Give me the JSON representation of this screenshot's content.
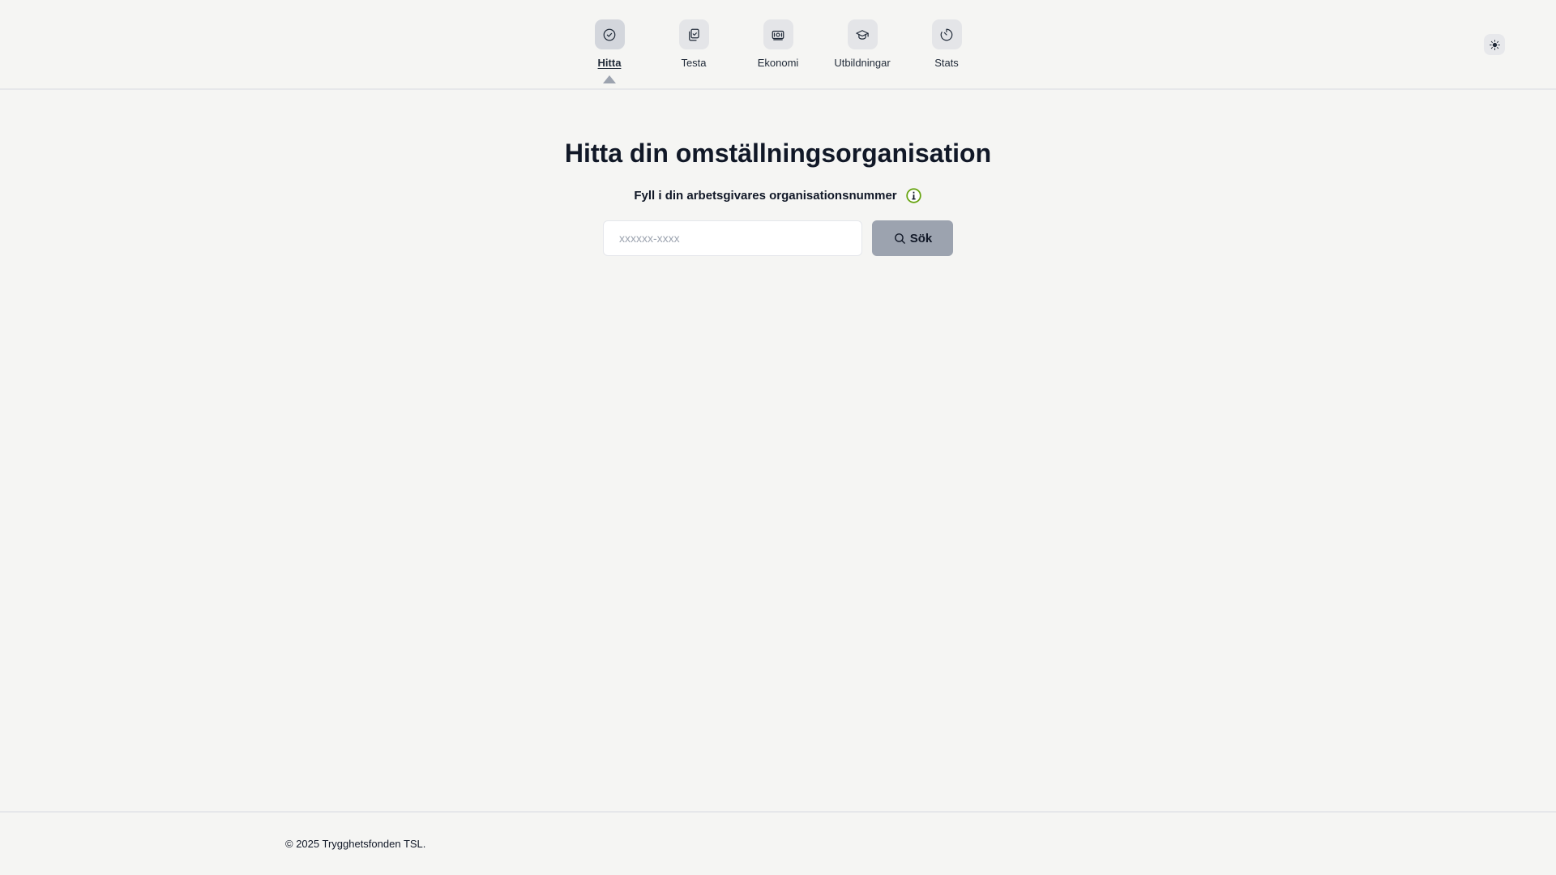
{
  "nav": {
    "items": [
      {
        "label": "Hitta",
        "icon": "check-circle-icon",
        "active": true
      },
      {
        "label": "Testa",
        "icon": "clipboard-copy-icon",
        "active": false
      },
      {
        "label": "Ekonomi",
        "icon": "banknote-icon",
        "active": false
      },
      {
        "label": "Utbildningar",
        "icon": "graduation-cap-icon",
        "active": false
      },
      {
        "label": "Stats",
        "icon": "timer-icon",
        "active": false
      }
    ]
  },
  "theme_toggle": {
    "icon": "sun-icon"
  },
  "main": {
    "title": "Hitta din omställningsorganisation",
    "subtitle": "Fyll i din arbetsgivares organisationsnummer",
    "info_icon": "info-icon",
    "search": {
      "value": "",
      "placeholder": "xxxxxx-xxxx",
      "button_label": "Sök",
      "button_icon": "search-icon"
    }
  },
  "footer": {
    "copyright": "© 2025 Trygghetsfonden TSL."
  },
  "colors": {
    "background": "#f5f5f3",
    "nav_icon_bg": "#e4e5e8",
    "nav_icon_active_bg": "#d3d6dc",
    "button_bg": "#9ca3af",
    "info_accent": "#65a30d"
  }
}
